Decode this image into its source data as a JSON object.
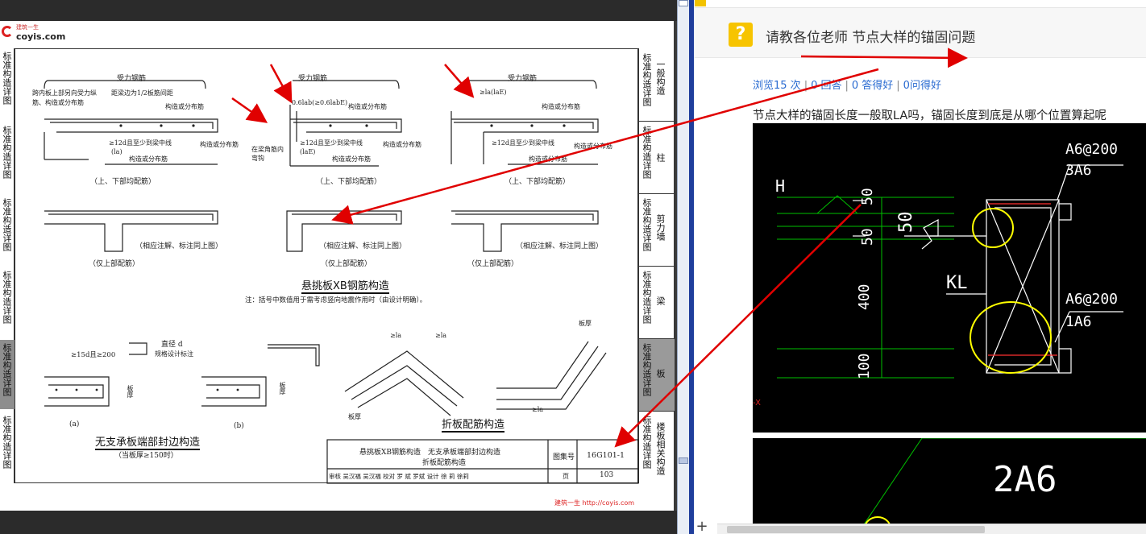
{
  "viewer": {
    "logo_small": "建筑一生",
    "logo_site": "coyis.com",
    "footer_watermark": "建筑一生 http://coyis.com"
  },
  "sidebar_left": [
    "标准构造详图",
    "标准构造详图",
    "标准构造详图",
    "标准构造详图",
    "标准构造详图",
    "标准构造详图"
  ],
  "sidebar_right": [
    {
      "label": "标准构造详图",
      "section": "一般构造"
    },
    {
      "label": "标准构造详图",
      "section": "柱"
    },
    {
      "label": "标准构造详图",
      "section": "剪力墙"
    },
    {
      "label": "标准构造详图",
      "section": "梁"
    },
    {
      "label": "标准构造详图",
      "section": "板"
    },
    {
      "label": "标准构造详图",
      "section": "楼板相关构造"
    }
  ],
  "drawing": {
    "rebar_label": "受力钢筋",
    "note_span": "跨内板上部另向受力纵筋、构造或分布筋",
    "dist_half_span": "距梁边为1/2板筋间距",
    "dist_rebar": "构造或分布筋",
    "dist_rebar2": "构造或分布筋",
    "la_half_1": "≥12d且至少到梁中线",
    "la_half_2": "≥12d且至少到梁中线",
    "la_half_3": "≥12d且至少到梁中线",
    "la_paren": "(la)",
    "la_paren2": "(laE)",
    "anchor_06": "0.6lab(≥0.6labE)",
    "dist_la": "≥la(laE)",
    "corner_hook": "在梁角筋内弯钩",
    "both_top_bottom": "（上、下部均配筋）",
    "see_above": "（相应注解、标注同上图）",
    "top_only": "（仅上部配筋）",
    "title_xb": "悬挑板XB钢筋构造",
    "note_bracket": "注：括号中数值用于需考虑竖向地震作用时（由设计明确）。",
    "dia_d": "直径 d",
    "dia_note": "规格设计标注",
    "edge_15d": "≥15d且≥200",
    "slab_thk": "板厚",
    "label_a": "(a)",
    "label_b": "(b)",
    "title_edge": "无支承板端部封边构造",
    "edge_cond": "（当板厚≥150时）",
    "title_fold": "折板配筋构造",
    "la": "≥la"
  },
  "title_block": {
    "line1": "悬挑板XB钢筋构造　无支承板端部封边构造",
    "line2": "折板配筋构造",
    "atlas_label": "图集号",
    "atlas_no": "16G101-1",
    "review_row": "审核 吴汉福 吴汉福 校对 罗 斌 罗斌 设计 徐 莉 徐莉",
    "page_label": "页",
    "page_no": "103"
  },
  "question": {
    "icon": "?",
    "title": "请教各位老师 节点大样的锚固问题",
    "views": "浏览15 次",
    "answers": "0 回答",
    "good_answers": "0 答得好",
    "asks_good": "0问得好",
    "body": "节点大样的锚固长度一般取LA吗，锚固长度到底是从哪个位置算起呢"
  },
  "cad_image": {
    "h_label": "H",
    "dim_50a": "50",
    "dim_50b": "50",
    "dim_50c": "50",
    "dim_400": "400",
    "dim_100": "100",
    "kl": "KL",
    "rebar_top1": "A6@200",
    "rebar_top2": "3A6",
    "rebar_bot1": "A6@200",
    "rebar_bot2": "1A6",
    "x_mark": "-X",
    "rebar_2a6": "2A6"
  },
  "colors": {
    "accent_blue": "#2a6bd1",
    "icon_yellow": "#f7c400",
    "annotation_red": "#e00000",
    "cad_yellow": "#ffff00",
    "cad_green": "#00c000"
  }
}
